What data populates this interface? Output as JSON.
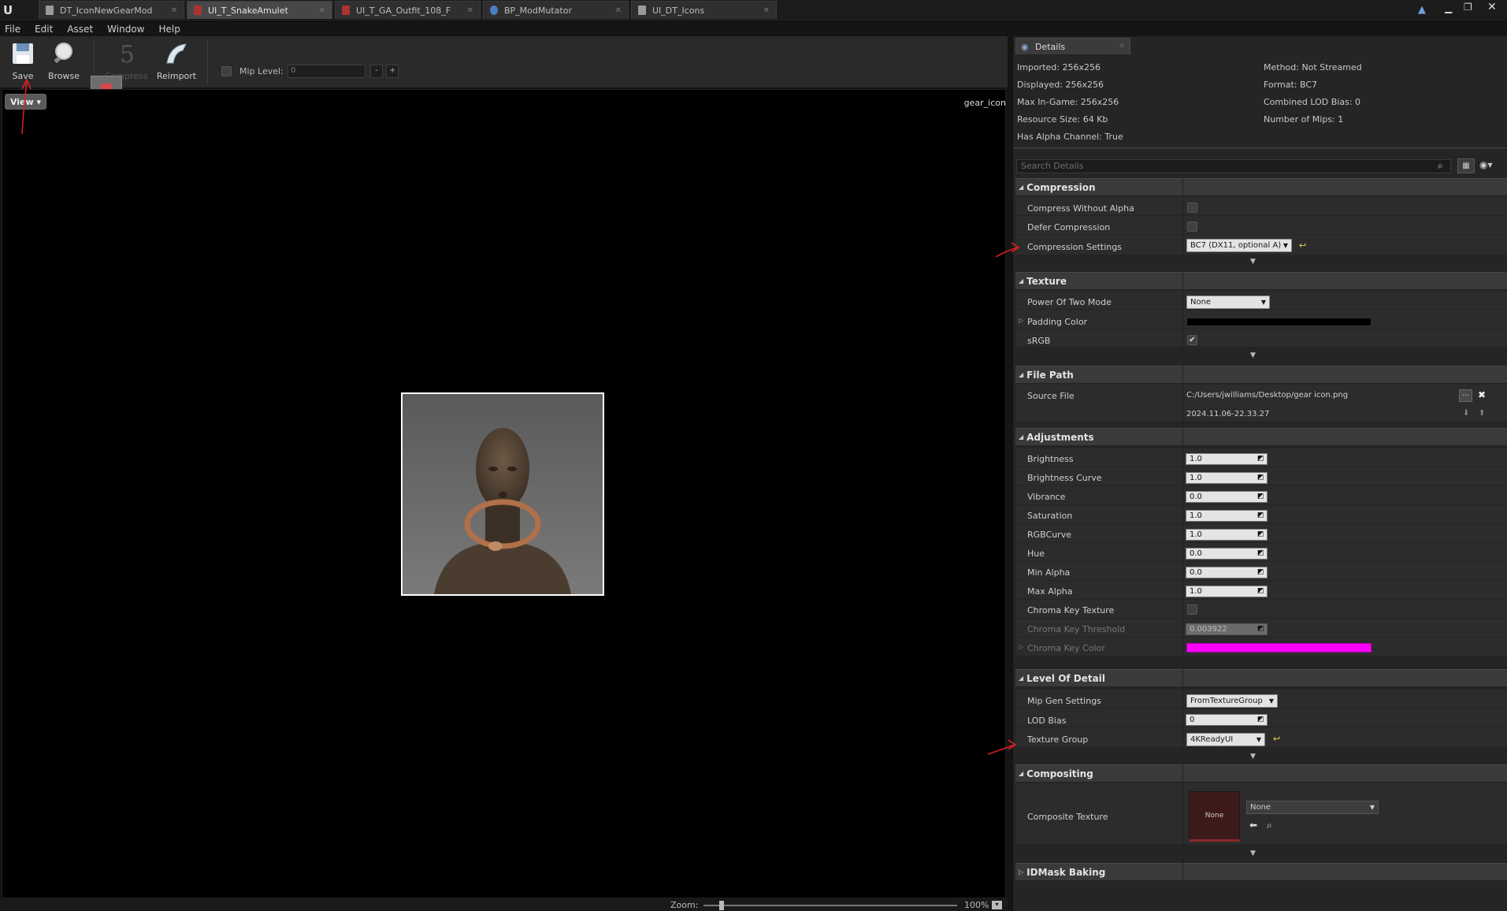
{
  "tabs": [
    {
      "label": "DT_IconNewGearMod",
      "icon": "table-icon",
      "active": false
    },
    {
      "label": "UI_T_SnakeAmulet",
      "icon": "texture-icon",
      "active": true
    },
    {
      "label": "UI_T_GA_Outfit_108_F",
      "icon": "texture-icon",
      "active": false
    },
    {
      "label": "BP_ModMutator",
      "icon": "blueprint-icon",
      "active": false
    },
    {
      "label": "UI_DT_Icons",
      "icon": "table-icon",
      "active": false
    }
  ],
  "menu": [
    "File",
    "Edit",
    "Asset",
    "Window",
    "Help"
  ],
  "toolbar": {
    "save": "Save",
    "browse": "Browse",
    "compress": "Compress",
    "reimport": "Reimport",
    "mip_label": "Mip Level:",
    "mip_value": "0",
    "minus": "-",
    "plus": "+"
  },
  "viewport": {
    "view_button": "View",
    "texture_name": "gear_icon"
  },
  "zoom": {
    "label": "Zoom:",
    "value": "100%"
  },
  "details": {
    "tab": "Details",
    "info_left": [
      "Imported: 256x256",
      "Displayed: 256x256",
      "Max In-Game: 256x256",
      "Resource Size: 64 Kb",
      "Has Alpha Channel: True"
    ],
    "info_right": [
      "Method: Not Streamed",
      "Format: BC7",
      "Combined LOD Bias: 0",
      "Number of Mips: 1"
    ],
    "search_placeholder": "Search Details",
    "compression": {
      "title": "Compression",
      "compress_without_alpha": "Compress Without Alpha",
      "defer_compression": "Defer Compression",
      "compression_settings": "Compression Settings",
      "compression_value": "BC7 (DX11, optional A)"
    },
    "texture": {
      "title": "Texture",
      "power_of_two": "Power Of Two Mode",
      "power_value": "None",
      "padding_color": "Padding Color",
      "srgb": "sRGB"
    },
    "file_path": {
      "title": "File Path",
      "source_file": "Source File",
      "path": "C:/Users/jwilliams/Desktop/gear icon.png",
      "timestamp": "2024.11.06-22.33.27",
      "browse_btn": "..."
    },
    "adjustments": {
      "title": "Adjustments",
      "rows": [
        {
          "label": "Brightness",
          "value": "1.0"
        },
        {
          "label": "Brightness Curve",
          "value": "1.0"
        },
        {
          "label": "Vibrance",
          "value": "0.0"
        },
        {
          "label": "Saturation",
          "value": "1.0"
        },
        {
          "label": "RGBCurve",
          "value": "1.0"
        },
        {
          "label": "Hue",
          "value": "0.0"
        },
        {
          "label": "Min Alpha",
          "value": "0.0"
        },
        {
          "label": "Max Alpha",
          "value": "1.0"
        }
      ],
      "chroma_key_texture": "Chroma Key Texture",
      "chroma_key_threshold": "Chroma Key Threshold",
      "chroma_threshold_value": "0.003922",
      "chroma_key_color": "Chroma Key Color"
    },
    "lod": {
      "title": "Level Of Detail",
      "mip_gen": "Mip Gen Settings",
      "mip_gen_value": "FromTextureGroup",
      "lod_bias": "LOD Bias",
      "lod_bias_value": "0",
      "texture_group": "Texture Group",
      "texture_group_value": "4KReadyUI"
    },
    "compositing": {
      "title": "Compositing",
      "composite_texture": "Composite Texture",
      "thumb": "None",
      "value": "None"
    },
    "idmask": {
      "title": "IDMask Baking"
    }
  },
  "colors": {
    "padding_color": "#000000",
    "chroma_key_color": "#ff00ff",
    "accent": "#e02020"
  }
}
